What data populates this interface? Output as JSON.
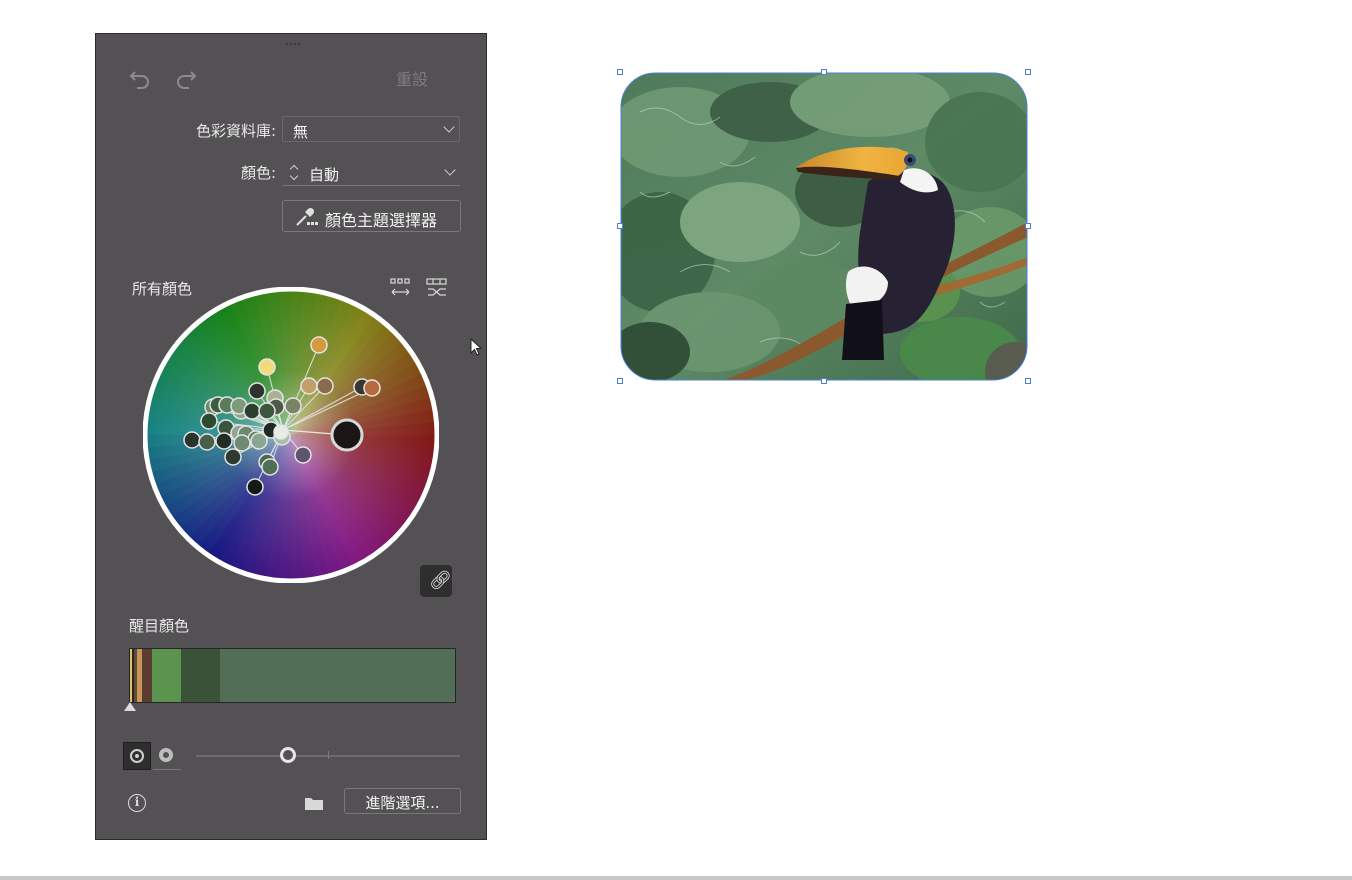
{
  "panel": {
    "toolbar": {
      "undo_icon": "undo-icon",
      "redo_icon": "redo-icon",
      "reset_label": "重設"
    },
    "library": {
      "label": "色彩資料庫:",
      "value": "無"
    },
    "colors": {
      "label": "顏色:",
      "value": "自動"
    },
    "theme_picker_label": "顏色主題選擇器",
    "all_colors_label": "所有顏色",
    "wheel_tools": [
      "arrange-colors-icon",
      "randomize-colors-icon"
    ],
    "link_icon": "link-harmony-icon",
    "prominent_label": "醒目顏色",
    "prominent_colors": [
      {
        "color": "#e2c067",
        "share": 0.006
      },
      {
        "color": "#2b2420",
        "share": 0.006
      },
      {
        "color": "#5e4a39",
        "share": 0.01
      },
      {
        "color": "#c99555",
        "share": 0.016
      },
      {
        "color": "#5a3d30",
        "share": 0.03
      },
      {
        "color": "#5b944f",
        "share": 0.09
      },
      {
        "color": "#3a5238",
        "share": 0.12
      },
      {
        "color": "#526e56",
        "share": 0.72
      }
    ],
    "slider_value": 0.35,
    "advanced_label": "進階選項..."
  },
  "colors": {
    "panel_bg": "#535153",
    "selection_blue": "#4a7fd9"
  }
}
